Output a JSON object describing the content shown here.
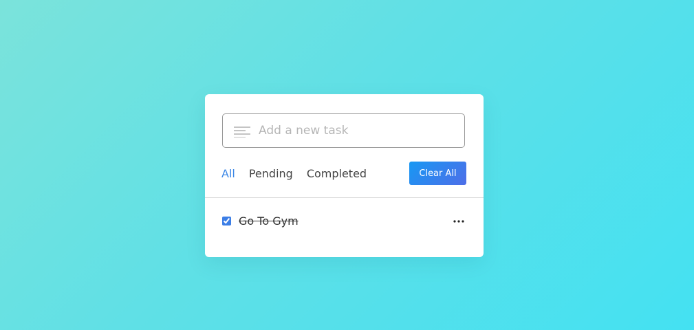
{
  "input": {
    "placeholder": "Add a new task",
    "value": "",
    "icon": "text-lines-icon"
  },
  "filters": [
    {
      "label": "All",
      "active": true
    },
    {
      "label": "Pending",
      "active": false
    },
    {
      "label": "Completed",
      "active": false
    }
  ],
  "clear_button": {
    "label": "Clear All"
  },
  "tasks": [
    {
      "name": "Go To Gym",
      "completed": true,
      "menu_icon": "more-horizontal-icon"
    }
  ],
  "colors": {
    "accent": "#3c87e6",
    "button_gradient_start": "#1798f3",
    "button_gradient_end": "#4e6ee8",
    "background_start": "#7be3db",
    "background_end": "#44e1f2"
  }
}
